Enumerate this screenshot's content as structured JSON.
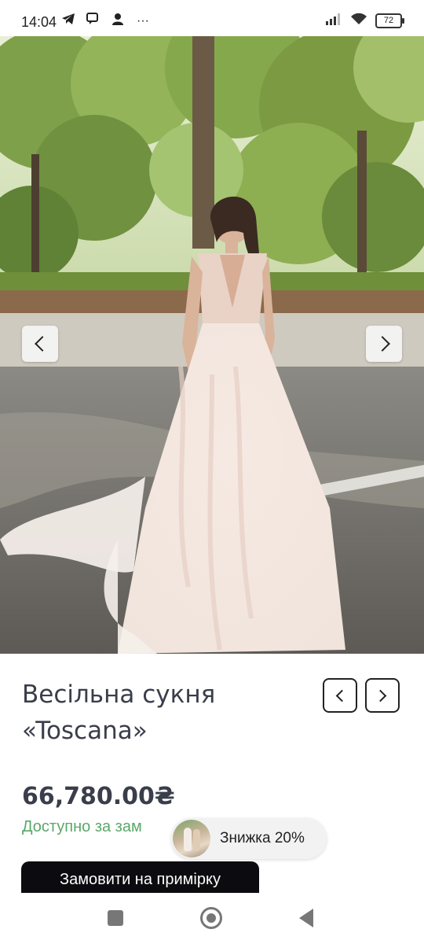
{
  "status_bar": {
    "time": "14:04",
    "icons_left": [
      "telegram-icon",
      "chat-icon",
      "person-icon",
      "more-icon"
    ],
    "more_glyph": "···",
    "icons_right": [
      "signal-icon",
      "wifi-icon",
      "battery-icon"
    ],
    "battery_level": "72"
  },
  "gallery": {
    "image": "wedding-dress-photo",
    "prev_icon": "chevron-left-icon",
    "next_icon": "chevron-right-icon"
  },
  "product": {
    "title_line1": "Весільна сукня",
    "title_line2": "«Toscana»",
    "price": "66,780.00₴",
    "availability": "Доступно за зам",
    "prev_icon": "chevron-left-icon",
    "next_icon": "chevron-right-icon"
  },
  "promo": {
    "label": "Знижка 20%"
  },
  "cta": {
    "label": "Замовити на примірку"
  },
  "colors": {
    "availability": "#5aa86a",
    "cta_background": "#0c0c10",
    "text": "#3a3e4a"
  }
}
